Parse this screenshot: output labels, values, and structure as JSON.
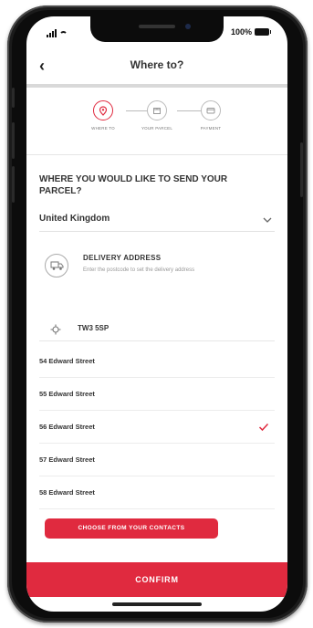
{
  "status_bar": {
    "battery": "100%"
  },
  "header": {
    "back_icon": "‹",
    "title": "Where to?"
  },
  "steps": [
    {
      "label": "WHERE TO",
      "icon": "location-pin-icon"
    },
    {
      "label": "YOUR PARCEL",
      "icon": "parcel-icon"
    },
    {
      "label": "PAYMENT",
      "icon": "card-icon"
    }
  ],
  "question": "WHERE YOU WOULD LIKE TO SEND YOUR PARCEL?",
  "country": {
    "selected": "United Kingdom"
  },
  "delivery": {
    "title": "DELIVERY ADDRESS",
    "subtitle": "Enter the postcode to set the delivery address"
  },
  "postcode": {
    "value": "TW3 5SP"
  },
  "addresses": [
    {
      "label": "54 Edward Street",
      "selected": false
    },
    {
      "label": "55 Edward Street",
      "selected": false
    },
    {
      "label": "56 Edward Street",
      "selected": true
    },
    {
      "label": "57 Edward Street",
      "selected": false
    },
    {
      "label": "58 Edward Street",
      "selected": false
    }
  ],
  "buttons": {
    "contacts": "CHOOSE FROM YOUR CONTACTS",
    "confirm": "CONFIRM"
  },
  "colors": {
    "accent": "#e02a3f",
    "divider": "#d9d9d9"
  }
}
